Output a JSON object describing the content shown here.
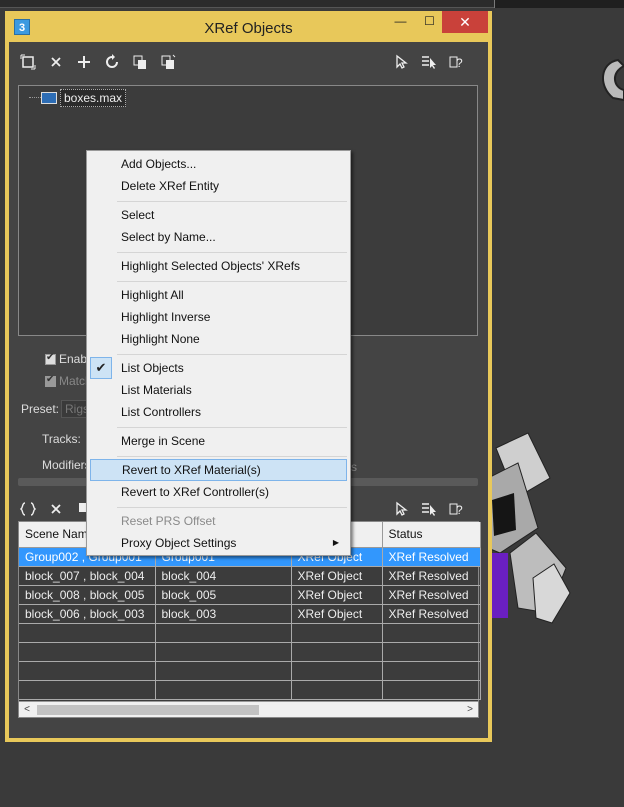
{
  "window": {
    "title": "XRef Objects",
    "app_icon": "3",
    "controls": {
      "minimize": "—",
      "maximize": "☐",
      "close": "✕"
    }
  },
  "top_toolbar": {
    "icons": [
      "select-all-icon",
      "close-icon",
      "add-icon",
      "refresh-icon",
      "copy-xref-icon",
      "merge-icon",
      "pointer-icon",
      "list-select-icon",
      "help-icon"
    ]
  },
  "tree": {
    "file_name": "boxes.max"
  },
  "options": {
    "enable_label": "Enable",
    "merge_label": "Match",
    "preset_label": "Preset:",
    "preset_value": "Rigs",
    "tracks_label": "Tracks:",
    "modifiers_label": "Modifiers",
    "modifiers_right": "rs"
  },
  "context_menu": {
    "items": [
      {
        "label": "Add Objects..."
      },
      {
        "label": "Delete XRef Entity"
      },
      {
        "label": "Select"
      },
      {
        "label": "Select by Name..."
      },
      {
        "label": "Highlight Selected Objects' XRefs"
      },
      {
        "label": "Highlight All"
      },
      {
        "label": "Highlight Inverse"
      },
      {
        "label": "Highlight None"
      },
      {
        "label": "List Objects"
      },
      {
        "label": "List Materials"
      },
      {
        "label": "List Controllers"
      },
      {
        "label": "Merge in Scene"
      },
      {
        "label": "Revert to XRef Material(s)"
      },
      {
        "label": "Revert to XRef Controller(s)"
      },
      {
        "label": "Reset PRS Offset"
      },
      {
        "label": "Proxy Object Settings"
      }
    ]
  },
  "table": {
    "headers": [
      "Scene Nam",
      "",
      "",
      "Status"
    ],
    "rows": [
      [
        "Group002 , Group001",
        "Group001",
        "XRef Object",
        "XRef Resolved"
      ],
      [
        "block_007 , block_004",
        "block_004",
        "XRef Object",
        "XRef Resolved"
      ],
      [
        "block_008 , block_005",
        "block_005",
        "XRef Object",
        "XRef Resolved"
      ],
      [
        "block_006 , block_003",
        "block_003",
        "XRef Object",
        "XRef Resolved"
      ]
    ]
  },
  "scroll": {
    "left_arrow": "<",
    "right_arrow": ">"
  },
  "colors": {
    "accent_title": "#e8c85a",
    "selection": "#3297fd",
    "close": "#c9413a"
  }
}
